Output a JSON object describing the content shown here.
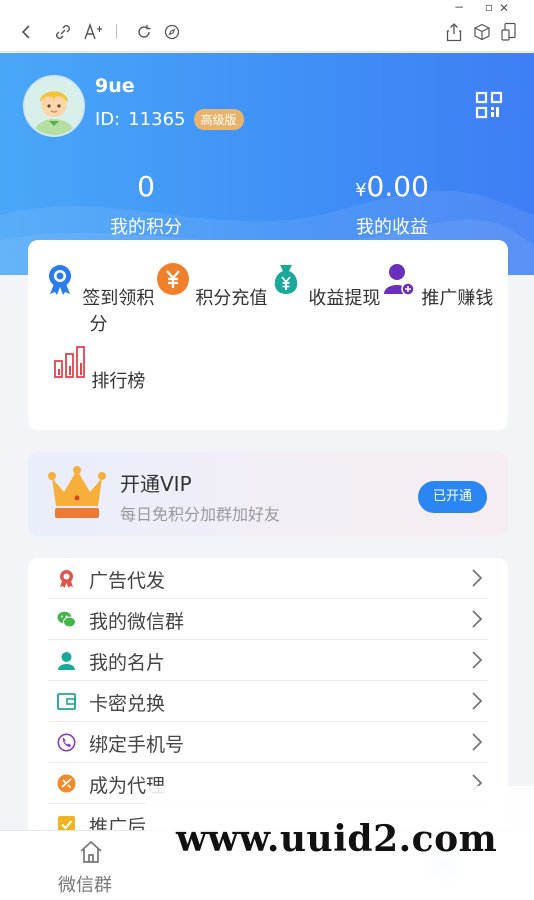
{
  "profile": {
    "name": "9ue",
    "id_label": "ID:",
    "id_value": "11365",
    "badge": "高级版"
  },
  "stats": [
    {
      "value": "0",
      "currency": "",
      "label": "我的积分"
    },
    {
      "value": "0.00",
      "currency": "¥",
      "label": "我的收益"
    }
  ],
  "quick_actions": [
    {
      "label": "签到领积分",
      "icon": "medal-icon",
      "color": "#2b7de9"
    },
    {
      "label": "积分充值",
      "icon": "yen-coin-icon",
      "color": "#f0812a"
    },
    {
      "label": "收益提现",
      "icon": "money-bag-icon",
      "color": "#1aa89a"
    },
    {
      "label": "推广赚钱",
      "icon": "user-add-icon",
      "color": "#6b2fbd"
    },
    {
      "label": "排行榜",
      "icon": "bar-chart-icon",
      "color": "#e0454b"
    }
  ],
  "vip": {
    "title": "开通VIP",
    "subtitle": "每日免积分加群加好友",
    "button": "已开通"
  },
  "menu": [
    {
      "label": "广告代发",
      "icon": "award-icon",
      "color": "#e0554b"
    },
    {
      "label": "我的微信群",
      "icon": "wechat-icon",
      "color": "#44b549"
    },
    {
      "label": "我的名片",
      "icon": "person-card-icon",
      "color": "#1aa89a"
    },
    {
      "label": "卡密兑换",
      "icon": "wallet-icon",
      "color": "#1aa89a"
    },
    {
      "label": "绑定手机号",
      "icon": "phone-icon",
      "color": "#8a3db8"
    },
    {
      "label": "成为代理",
      "icon": "agent-icon",
      "color": "#f08a2a"
    },
    {
      "label": "推广后",
      "icon": "checkbox-icon",
      "color": "#f0b323"
    }
  ],
  "tabbar": {
    "label": "微信群",
    "icon": "home-icon"
  },
  "watermark": "www.uuid2.com"
}
